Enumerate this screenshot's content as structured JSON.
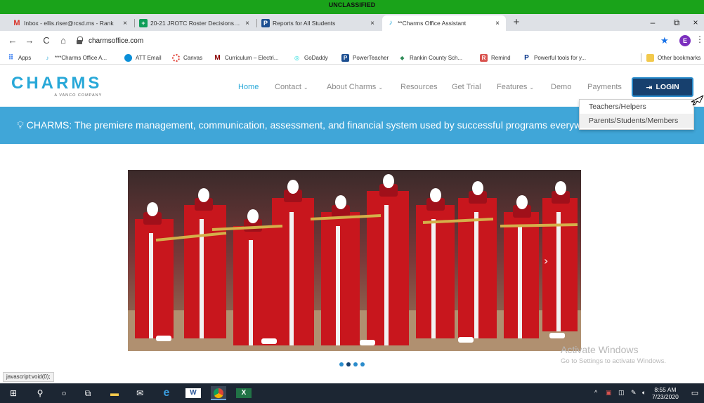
{
  "classification": "UNCLASSIFIED",
  "tabs": [
    {
      "label": "Inbox - ellis.riser@rcsd.ms - Rank",
      "close": "×"
    },
    {
      "label": "20-21 JROTC Roster Decisions - G",
      "close": "×"
    },
    {
      "label": "Reports for All Students",
      "close": "×"
    },
    {
      "label": "**Charms Office Assistant",
      "close": "×"
    }
  ],
  "new_tab": "+",
  "window_controls": {
    "minimize": "–",
    "restore": "⧉",
    "close": "×"
  },
  "nav": {
    "back": "←",
    "forward": "→",
    "reload": "C",
    "home": "⌂"
  },
  "address": "charmsoffice.com",
  "profile_initial": "E",
  "bookmarks": [
    {
      "label": "Apps"
    },
    {
      "label": "***Charms Office A..."
    },
    {
      "label": "ATT Email"
    },
    {
      "label": "Canvas"
    },
    {
      "label": "Curriculum – Electri..."
    },
    {
      "label": "GoDaddy"
    },
    {
      "label": "PowerTeacher"
    },
    {
      "label": "Rankin County Sch..."
    },
    {
      "label": "Remind"
    },
    {
      "label": "Powerful tools for y..."
    },
    {
      "label": "Other bookmarks"
    }
  ],
  "site": {
    "brand": "CHARMS",
    "tagline": "A VANCO COMPANY",
    "menu": [
      {
        "label": "Home"
      },
      {
        "label": "Contact",
        "chev": "⌄"
      },
      {
        "label": "About Charms",
        "chev": "⌄"
      },
      {
        "label": "Resources"
      },
      {
        "label": "Get Trial"
      },
      {
        "label": "Features",
        "chev": "⌄"
      },
      {
        "label": "Demo"
      },
      {
        "label": "Payments"
      }
    ],
    "login_label": "LOGIN",
    "login_dropdown": [
      "Teachers/Helpers",
      "Parents/Students/Members"
    ],
    "banner": "CHARMS: The premiere management, communication, assessment, and financial system used by successful programs everywhere",
    "carousel": {
      "slides": 4,
      "active_index": 1
    }
  },
  "status_url": "javascript:void(0);",
  "watermark": {
    "line1": "Activate Windows",
    "line2": "Go to Settings to activate Windows."
  },
  "clock": {
    "time": "8:55 AM",
    "date": "7/23/2020"
  },
  "colors": {
    "accent": "#28a8d8",
    "login": "#17406e",
    "banner": "#40a6d8",
    "classification": "#1aa31a"
  }
}
